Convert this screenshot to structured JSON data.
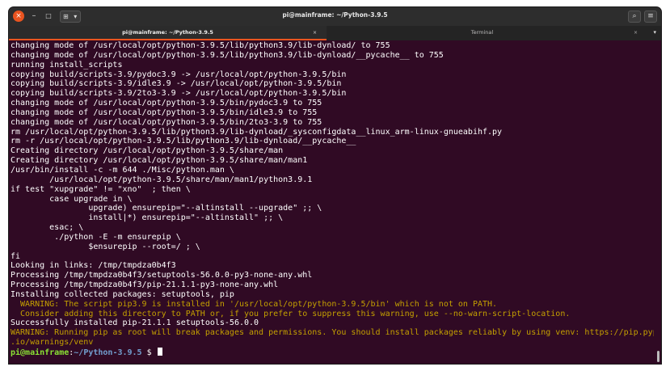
{
  "window": {
    "title": "pi@mainframe: ~/Python-3.9.5",
    "close_glyph": "×",
    "minimize_glyph": "–",
    "maximize_glyph": "□",
    "newtab_glyph": "⊞",
    "newtab_dropdown_glyph": "▾",
    "search_glyph": "⌕",
    "menu_glyph": "≡"
  },
  "tabs": [
    {
      "label": "pi@mainframe: ~/Python-3.9.5",
      "close_glyph": "×",
      "active": true
    },
    {
      "label": "Terminal",
      "close_glyph": "×",
      "active": false
    }
  ],
  "tab_menu_glyph": "▾",
  "terminal": {
    "lines": [
      {
        "text": "changing mode of /usr/local/opt/python-3.9.5/lib/python3.9/lib-dynload/ to 755",
        "style": "normal"
      },
      {
        "text": "changing mode of /usr/local/opt/python-3.9.5/lib/python3.9/lib-dynload/__pycache__ to 755",
        "style": "normal"
      },
      {
        "text": "running install_scripts",
        "style": "normal"
      },
      {
        "text": "copying build/scripts-3.9/pydoc3.9 -> /usr/local/opt/python-3.9.5/bin",
        "style": "normal"
      },
      {
        "text": "copying build/scripts-3.9/idle3.9 -> /usr/local/opt/python-3.9.5/bin",
        "style": "normal"
      },
      {
        "text": "copying build/scripts-3.9/2to3-3.9 -> /usr/local/opt/python-3.9.5/bin",
        "style": "normal"
      },
      {
        "text": "changing mode of /usr/local/opt/python-3.9.5/bin/pydoc3.9 to 755",
        "style": "normal"
      },
      {
        "text": "changing mode of /usr/local/opt/python-3.9.5/bin/idle3.9 to 755",
        "style": "normal"
      },
      {
        "text": "changing mode of /usr/local/opt/python-3.9.5/bin/2to3-3.9 to 755",
        "style": "normal"
      },
      {
        "text": "rm /usr/local/opt/python-3.9.5/lib/python3.9/lib-dynload/_sysconfigdata__linux_arm-linux-gnueabihf.py",
        "style": "normal"
      },
      {
        "text": "rm -r /usr/local/opt/python-3.9.5/lib/python3.9/lib-dynload/__pycache__",
        "style": "normal"
      },
      {
        "text": "Creating directory /usr/local/opt/python-3.9.5/share/man",
        "style": "normal"
      },
      {
        "text": "Creating directory /usr/local/opt/python-3.9.5/share/man/man1",
        "style": "normal"
      },
      {
        "text": "/usr/bin/install -c -m 644 ./Misc/python.man \\",
        "style": "normal"
      },
      {
        "text": "        /usr/local/opt/python-3.9.5/share/man/man1/python3.9.1",
        "style": "normal"
      },
      {
        "text": "if test \"xupgrade\" != \"xno\"  ; then \\",
        "style": "normal"
      },
      {
        "text": "        case upgrade in \\",
        "style": "normal"
      },
      {
        "text": "                upgrade) ensurepip=\"--altinstall --upgrade\" ;; \\",
        "style": "normal"
      },
      {
        "text": "                install|*) ensurepip=\"--altinstall\" ;; \\",
        "style": "normal"
      },
      {
        "text": "        esac; \\",
        "style": "normal"
      },
      {
        "text": "         ./python -E -m ensurepip \\",
        "style": "normal"
      },
      {
        "text": "                $ensurepip --root=/ ; \\",
        "style": "normal"
      },
      {
        "text": "fi",
        "style": "normal"
      },
      {
        "text": "Looking in links: /tmp/tmpdza0b4f3",
        "style": "normal"
      },
      {
        "text": "Processing /tmp/tmpdza0b4f3/setuptools-56.0.0-py3-none-any.whl",
        "style": "normal"
      },
      {
        "text": "Processing /tmp/tmpdza0b4f3/pip-21.1.1-py3-none-any.whl",
        "style": "normal"
      },
      {
        "text": "Installing collected packages: setuptools, pip",
        "style": "normal"
      },
      {
        "text": "  WARNING: The script pip3.9 is installed in '/usr/local/opt/python-3.9.5/bin' which is not on PATH.",
        "style": "warn"
      },
      {
        "text": "  Consider adding this directory to PATH or, if you prefer to suppress this warning, use --no-warn-script-location.",
        "style": "warn"
      },
      {
        "text": "Successfully installed pip-21.1.1 setuptools-56.0.0",
        "style": "normal"
      },
      {
        "text": "WARNING: Running pip as root will break packages and permissions. You should install packages reliably by using venv: https://pip.pypa",
        "style": "warn"
      },
      {
        "text": ".io/warnings/venv",
        "style": "warn"
      }
    ],
    "prompt": {
      "user_host": "pi@mainframe",
      "separator": ":",
      "path": "~/Python-3.9.5",
      "symbol": " $ "
    }
  },
  "colors": {
    "background": "#300a24",
    "warning": "#c4a000",
    "prompt_user": "#8ae234",
    "prompt_path": "#729fcf",
    "accent_tab": "#e95420"
  }
}
